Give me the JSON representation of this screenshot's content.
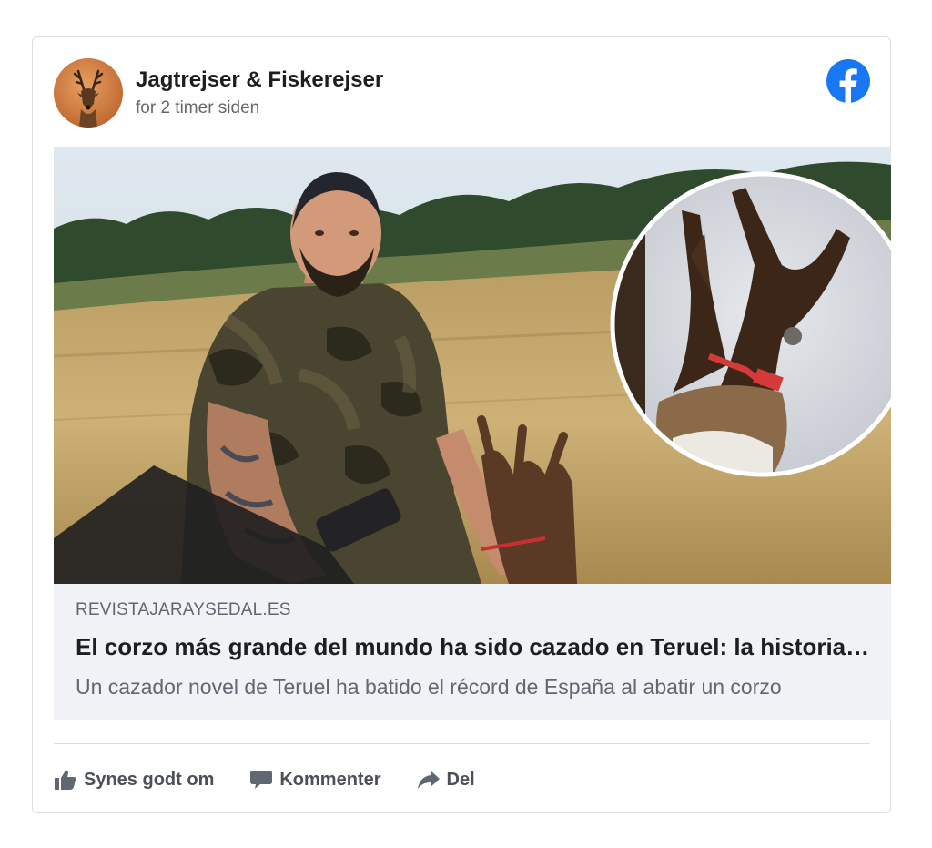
{
  "post": {
    "page_name": "Jagtrejser & Fiskerejser",
    "time": "for 2 timer siden"
  },
  "link_preview": {
    "domain": "REVISTAJARAYSEDAL.ES",
    "title": "El corzo más grande del mundo ha sido cazado en Teruel: la historia del récord",
    "description": "Un cazador novel de Teruel ha batido el récord de España al abatir un corzo"
  },
  "actions": {
    "like": "Synes godt om",
    "comment": "Kommenter",
    "share": "Del"
  },
  "icons": {
    "platform": "facebook-icon",
    "like": "thumbs-up-icon",
    "comment": "speech-bubble-icon",
    "share": "share-arrow-icon"
  },
  "colors": {
    "facebook_blue": "#1877f2",
    "link_box_bg": "#f0f2f5",
    "action_text": "#4b4f56"
  }
}
